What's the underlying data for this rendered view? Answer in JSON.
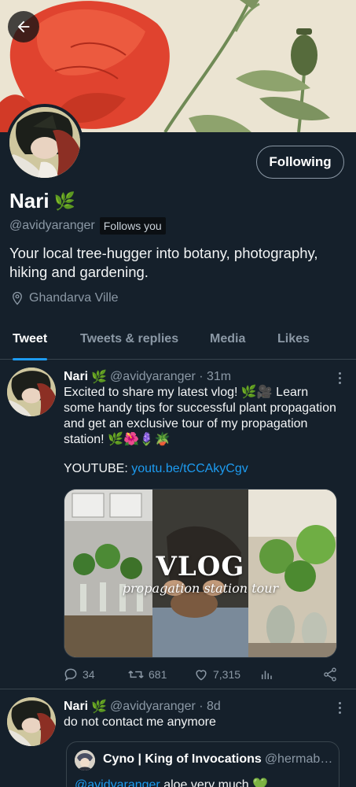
{
  "profile": {
    "name": "Nari",
    "name_emoji": "🌿",
    "handle": "@avidyaranger",
    "follows_you": "Follows you",
    "bio": "Your local tree-hugger into botany, photography, hiking and gardening.",
    "location": "Ghandarva Ville",
    "follow_button": "Following"
  },
  "tabs": [
    "Tweet",
    "Tweets & replies",
    "Media",
    "Likes"
  ],
  "tweets": [
    {
      "name": "Nari",
      "name_emoji": "🌿",
      "handle_time": "@avidyaranger · 31m",
      "text": "Excited to share my latest vlog! 🌿🎥 Learn some handy tips for successful plant propagation and get an exclusive tour of my propagation station! 🌿🌺🪻🪴",
      "link_label": "YOUTUBE: ",
      "link": "youtu.be/tCCAkyCgv",
      "media_title": "VLOG",
      "media_subtitle": "propagation station tour",
      "replies": "34",
      "retweets": "681",
      "likes": "7,315"
    },
    {
      "name": "Nari",
      "name_emoji": "🌿",
      "handle_time": "@avidyaranger · 8d",
      "text": "do not contact me anymore",
      "quote": {
        "name": "Cyno | King of Invocations",
        "handle": "@hermabu...",
        "mention": "@avidyaranger",
        "text": " aloe very much 💚"
      }
    }
  ],
  "colors": {
    "background": "#15202b",
    "accent": "#1d9bf0",
    "secondary_text": "#8b98a5",
    "divider": "#38444d"
  }
}
